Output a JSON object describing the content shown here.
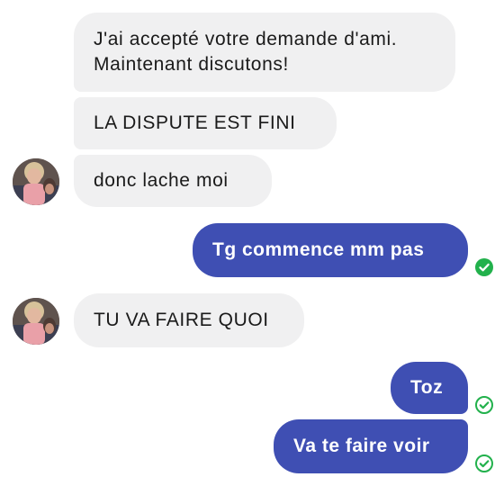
{
  "conversation": {
    "messages": [
      {
        "direction": "incoming",
        "text": "J'ai accepté votre demande d'ami. Maintenant discutons!"
      },
      {
        "direction": "incoming",
        "text": "LA DISPUTE EST FINI"
      },
      {
        "direction": "incoming",
        "text": "donc lache moi"
      },
      {
        "direction": "outgoing",
        "text": "Tg commence mm pas",
        "status": "delivered"
      },
      {
        "direction": "incoming",
        "text": "TU VA FAIRE QUOI"
      },
      {
        "direction": "outgoing",
        "text": "Toz",
        "status": "delivered"
      },
      {
        "direction": "outgoing",
        "text": "Va te faire voir",
        "status": "delivered"
      }
    ]
  },
  "contact": {
    "avatar_icon": "contact-avatar-photo"
  },
  "icons": {
    "delivered": "check-circle-icon"
  },
  "colors": {
    "incoming_bubble": "#f0f0f1",
    "outgoing_bubble": "#3f4fb3",
    "delivered_check": "#22b14c"
  }
}
